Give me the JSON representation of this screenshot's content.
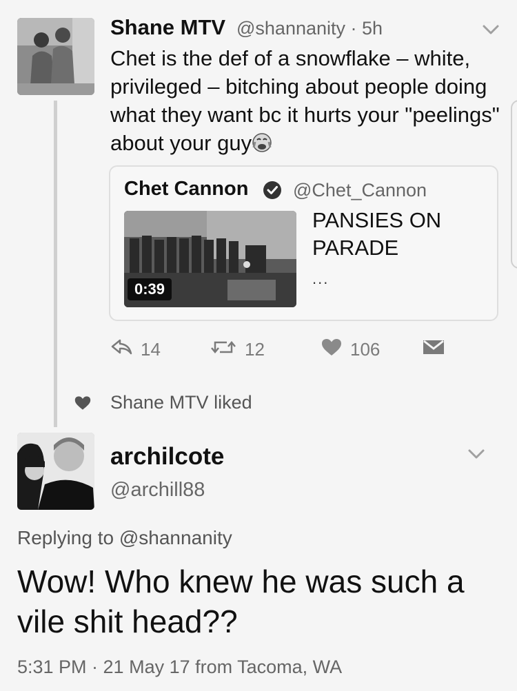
{
  "tweet": {
    "author_name": "Shane MTV",
    "handle_time": "@shannanity · 5h",
    "text": "Chet is the def of a snowflake – white, privileged – bitching about people doing what they want bc it hurts your \"peelings\" about your guy",
    "emoji": "crying-face",
    "quote": {
      "author_name": "Chet Cannon",
      "handle": "@Chet_Cannon",
      "verified": true,
      "video_duration": "0:39",
      "text": "PANSIES ON PARADE",
      "ellipsis": "..."
    },
    "actions": {
      "replies": "14",
      "retweets": "12",
      "likes": "106"
    }
  },
  "social_context": "Shane MTV liked",
  "reply": {
    "author_name": "archilcote",
    "handle": "@archill88",
    "replying_to": "Replying to @shannanity",
    "text": "Wow! Who knew he was such a vile shit head??",
    "meta": "5:31 PM · 21 May 17 from Tacoma, WA"
  },
  "colors": {
    "text": "#111111",
    "muted": "#666666",
    "background": "#f5f5f5"
  }
}
